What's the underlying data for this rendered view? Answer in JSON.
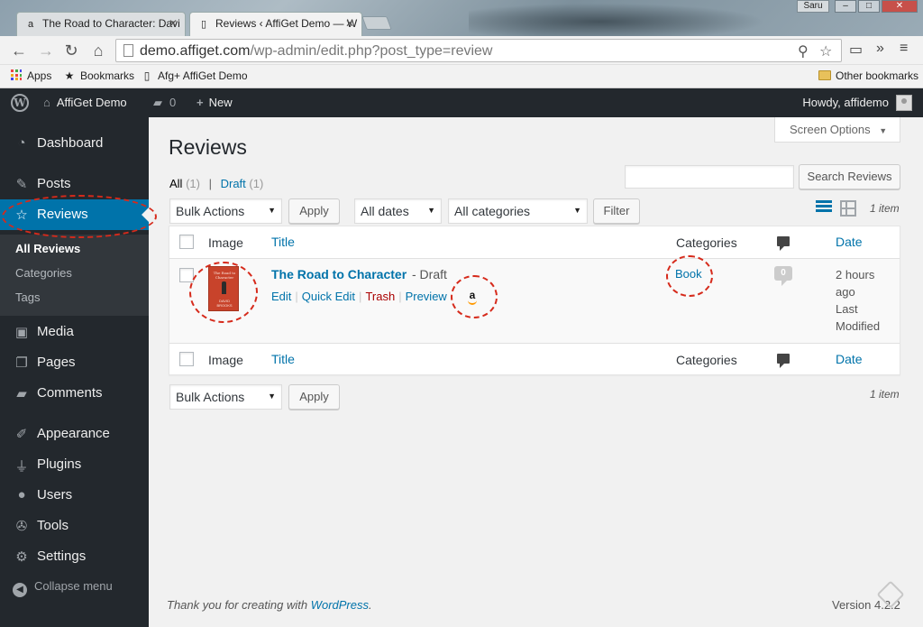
{
  "browser": {
    "tabs": [
      {
        "label": "The Road to Character: Davi",
        "favicon": "a"
      },
      {
        "label": "Reviews ‹ AffiGet Demo — W",
        "favicon": "page"
      }
    ],
    "user_chip": "Saru",
    "window_buttons": [
      "–",
      "□",
      "✕"
    ],
    "url_host": "demo.affiget.com",
    "url_path": "/wp-admin/edit.php?post_type=review",
    "bookmarks": [
      {
        "label": "Apps",
        "icon": "apps-grid-icon"
      },
      {
        "label": "Bookmarks",
        "icon": "star-icon"
      },
      {
        "label": "Afg+ AffiGet Demo",
        "icon": "page-icon"
      }
    ],
    "other_bookmarks": "Other bookmarks"
  },
  "adminbar": {
    "site_name": "AffiGet Demo",
    "comments_count": "0",
    "new_label": "New",
    "howdy": "Howdy, affidemo"
  },
  "sidebar": {
    "items": [
      {
        "label": "Dashboard",
        "icon": "dashboard-icon"
      },
      {
        "label": "Posts",
        "icon": "pushpin-icon"
      },
      {
        "label": "Reviews",
        "icon": "star-icon"
      },
      {
        "label": "Media",
        "icon": "media-icon"
      },
      {
        "label": "Pages",
        "icon": "pages-icon"
      },
      {
        "label": "Comments",
        "icon": "comment-icon"
      },
      {
        "label": "Appearance",
        "icon": "brush-icon"
      },
      {
        "label": "Plugins",
        "icon": "plug-icon"
      },
      {
        "label": "Users",
        "icon": "users-icon"
      },
      {
        "label": "Tools",
        "icon": "wrench-icon"
      },
      {
        "label": "Settings",
        "icon": "settings-icon"
      }
    ],
    "submenu": [
      "All Reviews",
      "Categories",
      "Tags"
    ],
    "collapse": "Collapse menu"
  },
  "main": {
    "screen_options": "Screen Options",
    "title": "Reviews",
    "filters": {
      "all": "All",
      "all_count": "(1)",
      "sep": "|",
      "draft": "Draft",
      "draft_count": "(1)"
    },
    "search_placeholder": "",
    "search_button": "Search Reviews",
    "bulk_actions": "Bulk Actions",
    "apply": "Apply",
    "all_dates": "All dates",
    "all_categories": "All categories",
    "filter_button": "Filter",
    "items_count": "1 item",
    "columns": {
      "image": "Image",
      "title": "Title",
      "categories": "Categories",
      "date": "Date"
    },
    "rows": [
      {
        "title": "The Road to Character",
        "state": "- Draft",
        "book_cover_title": "The Road to Character",
        "book_cover_author": "DAVID BROOKS",
        "actions": {
          "edit": "Edit",
          "quick_edit": "Quick Edit",
          "trash": "Trash",
          "preview": "Preview"
        },
        "category": "Book",
        "comments": "0",
        "date_line1": "2 hours",
        "date_line2": "ago",
        "date_line3": "Last",
        "date_line4": "Modified"
      }
    ]
  },
  "footer": {
    "thanks_prefix": "Thank you for creating with",
    "wp_link": "WordPress",
    "thanks_suffix": ".",
    "version": "Version 4.2.2"
  },
  "colors": {
    "admin_dark": "#23282d",
    "accent": "#0073aa",
    "annotation": "#d62a1b",
    "trash": "#a00"
  }
}
